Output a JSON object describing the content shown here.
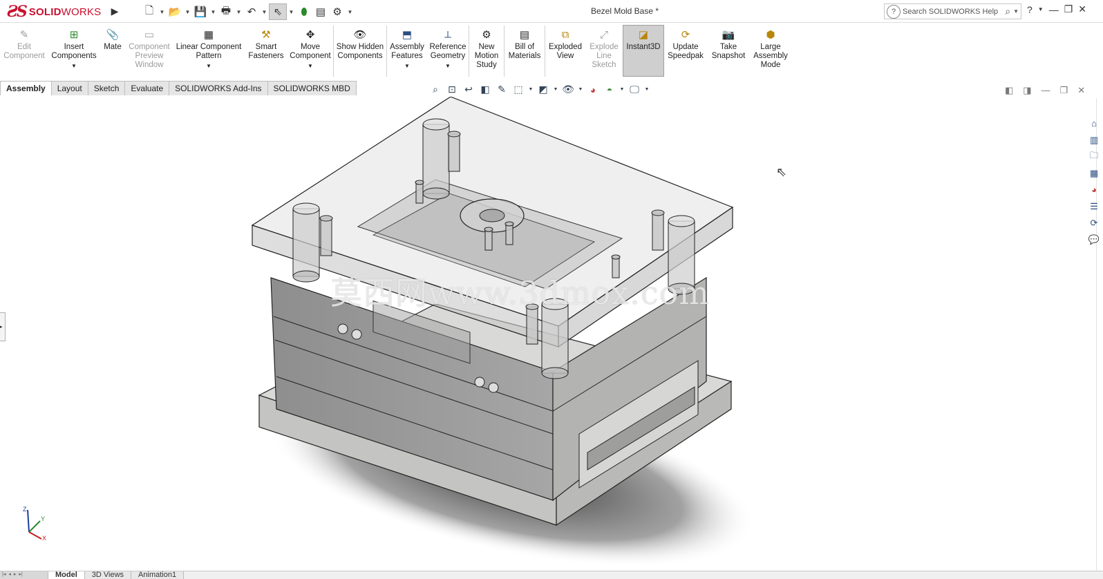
{
  "app": {
    "logo_ds": "ƧS",
    "logo_name_bold": "SOLID",
    "logo_name_light": "WORKS"
  },
  "document_title": "Bezel Mold Base *",
  "search": {
    "placeholder": "Search SOLIDWORKS Help"
  },
  "ribbon": {
    "edit_component": "Edit Component",
    "insert_components": "Insert Components",
    "mate": "Mate",
    "component_preview": "Component Preview Window",
    "linear_pattern": "Linear Component Pattern",
    "smart_fasteners": "Smart Fasteners",
    "move_component": "Move Component",
    "show_hidden": "Show Hidden Components",
    "assembly_features": "Assembly Features",
    "reference_geometry": "Reference Geometry",
    "new_motion_study": "New Motion Study",
    "bill_of_materials": "Bill of Materials",
    "exploded_view": "Exploded View",
    "explode_line_sketch": "Explode Line Sketch",
    "instant3d": "Instant3D",
    "update_speedpak": "Update Speedpak",
    "take_snapshot": "Take Snapshot",
    "large_assembly_mode": "Large Assembly Mode"
  },
  "tabs": [
    "Assembly",
    "Layout",
    "Sketch",
    "Evaluate",
    "SOLIDWORKS Add-Ins",
    "SOLIDWORKS MBD"
  ],
  "viewport": {
    "watermark": "莫西网www.3dmox.com"
  },
  "triad": {
    "x": "X",
    "y": "Y",
    "z": "Z"
  },
  "bottom_tabs": [
    "Model",
    "3D Views",
    "Animation1"
  ],
  "colors": {
    "brand": "#c8102e",
    "accent": "#2a4f80"
  }
}
